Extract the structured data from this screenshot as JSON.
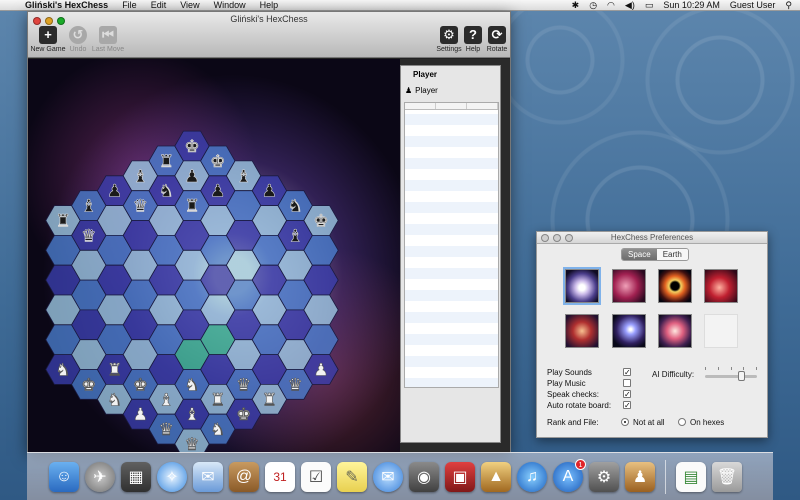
{
  "menubar": {
    "app_name": "Gliński's HexChess",
    "menus": [
      "File",
      "Edit",
      "View",
      "Window",
      "Help"
    ],
    "clock": "Sun 10:29 AM",
    "user": "Guest User"
  },
  "main_window": {
    "title": "Gliński's HexChess",
    "toolbar": {
      "new_game": "New Game",
      "undo": "Undo",
      "last_move": "Last Move",
      "settings": "Settings",
      "help": "Help",
      "rotate": "Rotate"
    },
    "move_panel": {
      "title": "Player",
      "player_label": "Player"
    }
  },
  "board": {
    "colors": {
      "light": "#9ecbe6",
      "mid": "#4a7fcf",
      "dark": "#3a3fae",
      "highlight": "#3fbf9a"
    },
    "pieces_white": 18,
    "pieces_black": 18
  },
  "prefs": {
    "title": "HexChess Preferences",
    "tabs": [
      "Space",
      "Earth"
    ],
    "active_tab": "Space",
    "play_sounds": "Play Sounds",
    "play_music": "Play Music",
    "speak_checks": "Speak checks:",
    "auto_rotate": "Auto rotate board:",
    "ai_difficulty": "AI Difficulty:",
    "ai_level": 0.7,
    "rank_file": "Rank and File:",
    "option_not_at_all": "Not at all",
    "option_on_hexes": "On hexes"
  },
  "dock": {
    "badge_count": "1"
  }
}
